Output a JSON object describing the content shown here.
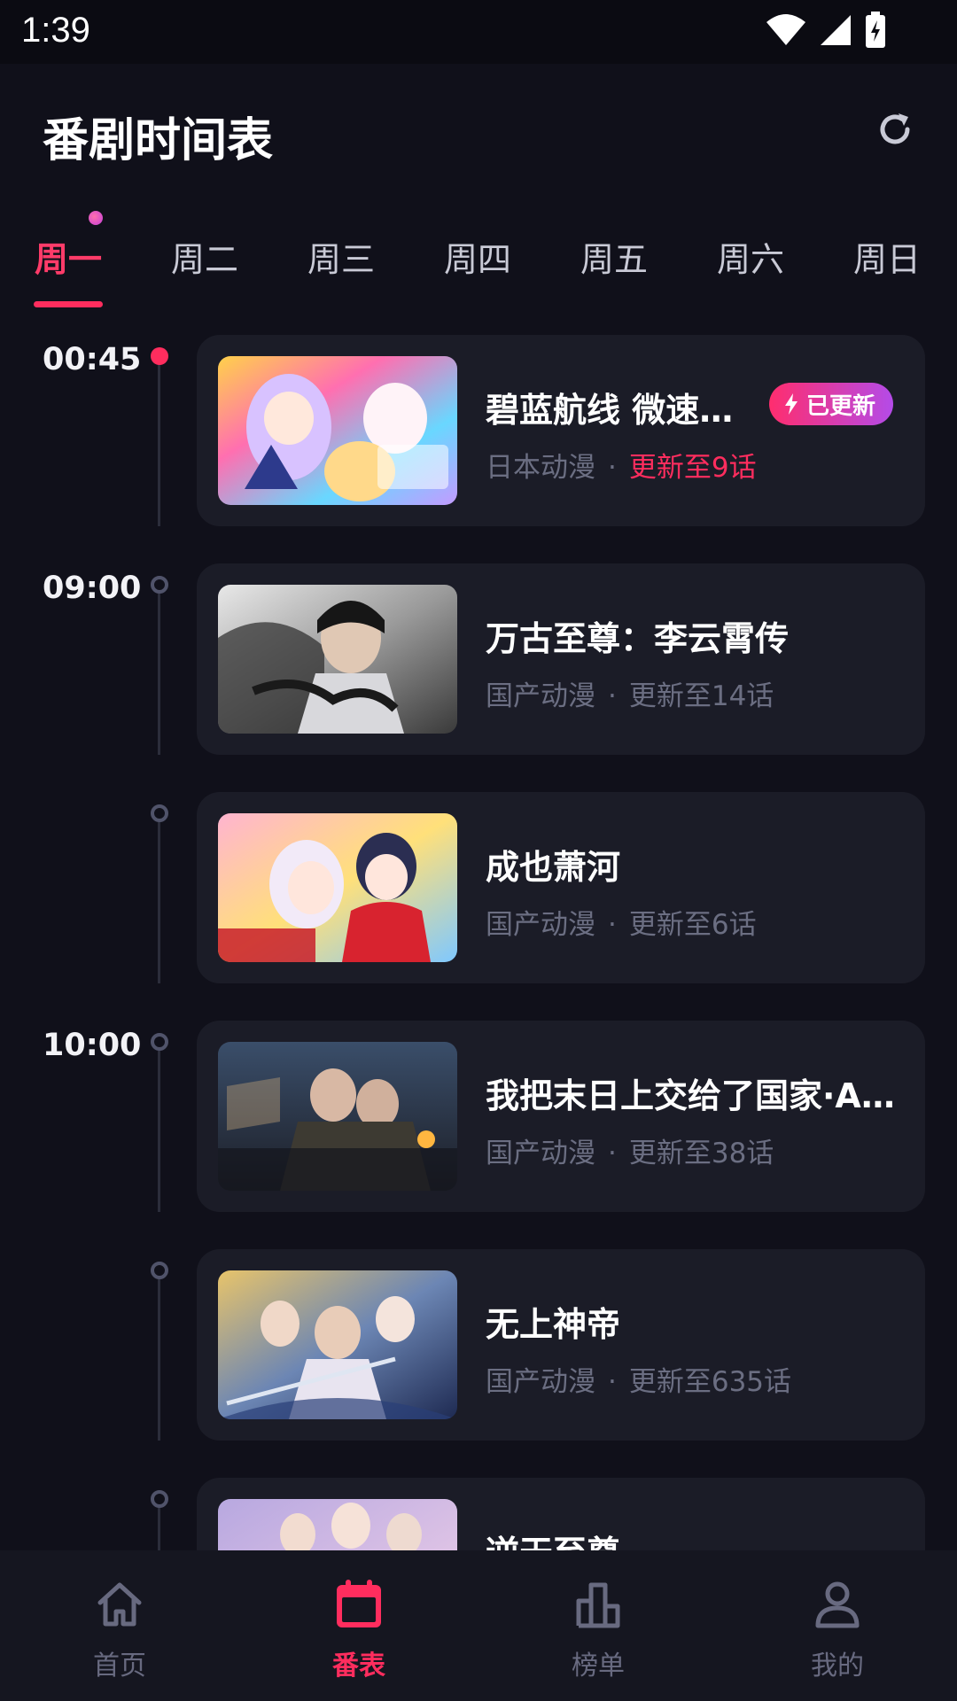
{
  "status_bar": {
    "time": "1:39"
  },
  "header": {
    "title": "番剧时间表"
  },
  "tabs": [
    {
      "label": "周一",
      "active": true
    },
    {
      "label": "周二"
    },
    {
      "label": "周三"
    },
    {
      "label": "周四"
    },
    {
      "label": "周五"
    },
    {
      "label": "周六"
    },
    {
      "label": "周日"
    }
  ],
  "schedule": [
    {
      "time": "00:45",
      "title": "碧蓝航线 微速…",
      "origin": "日本动漫",
      "separator": "·",
      "update": "更新至9话",
      "badge": "已更新",
      "icon": "lightning-icon"
    },
    {
      "time": "09:00",
      "title": "万古至尊：李云霄传",
      "origin": "国产动漫",
      "separator": "·",
      "update": "更新至14话"
    },
    {
      "time": "",
      "title": "成也萧河",
      "origin": "国产动漫",
      "separator": "·",
      "update": "更新至6话"
    },
    {
      "time": "10:00",
      "title": "我把末日上交给了国家·A…",
      "origin": "国产动漫",
      "separator": "·",
      "update": "更新至38话"
    },
    {
      "time": "",
      "title": "无上神帝",
      "origin": "国产动漫",
      "separator": "·",
      "update": "更新至635话"
    },
    {
      "time": "",
      "title": "逆天至尊",
      "origin": "",
      "separator": "",
      "update": ""
    }
  ],
  "bottom_nav": [
    {
      "label": "首页",
      "icon": "home-icon"
    },
    {
      "label": "番表",
      "icon": "calendar-icon",
      "active": true
    },
    {
      "label": "榜单",
      "icon": "chart-icon"
    },
    {
      "label": "我的",
      "icon": "person-icon"
    }
  ],
  "colors": {
    "accent": "#ff2d5e",
    "background": "#10101a",
    "card": "#1b1c27",
    "muted": "#6b6e82"
  }
}
